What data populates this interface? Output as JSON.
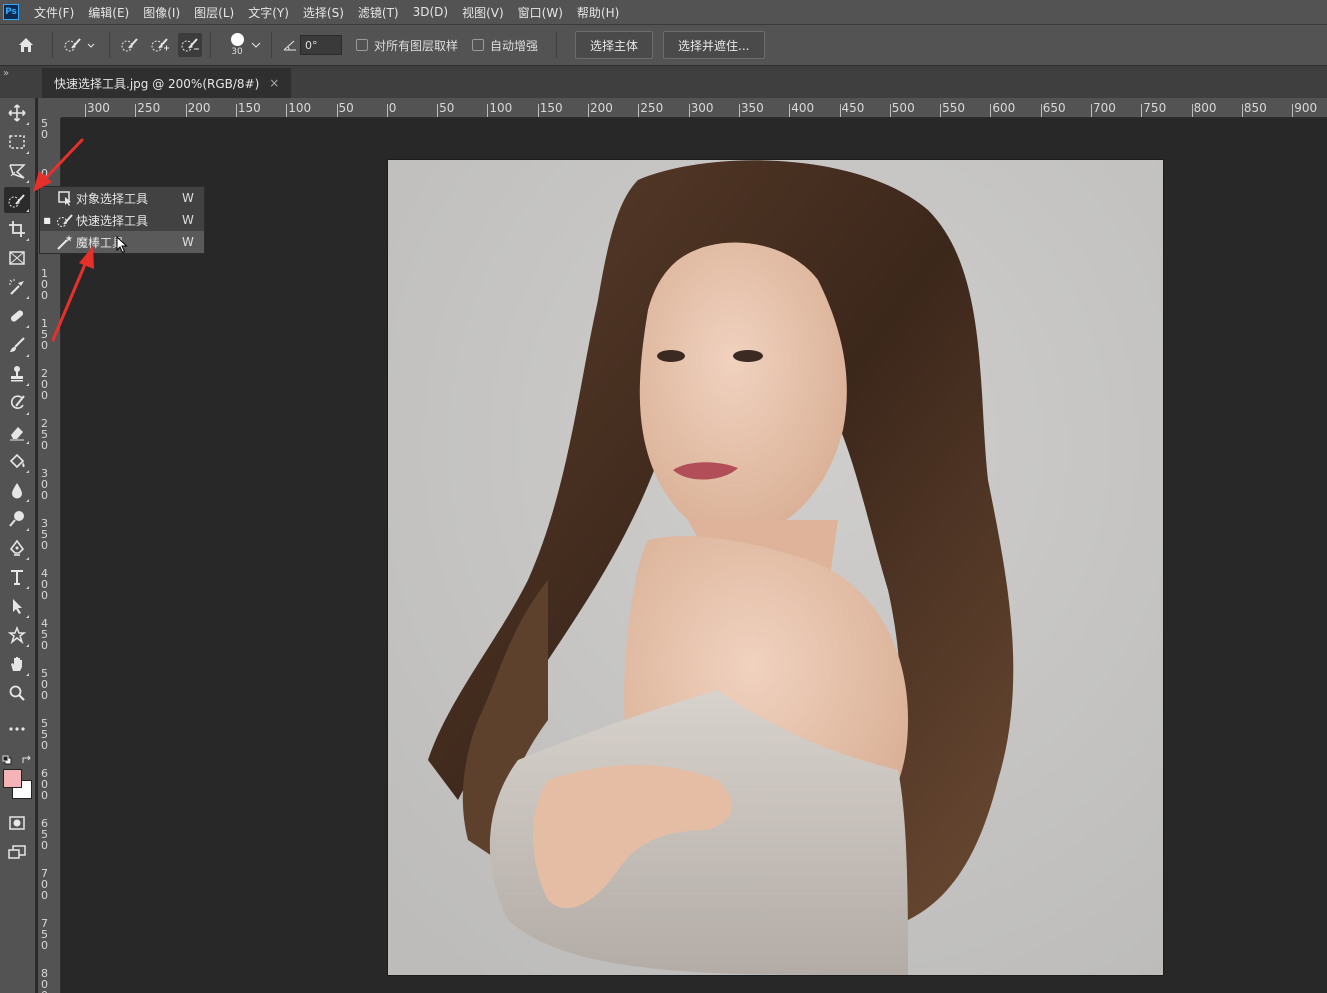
{
  "app": {
    "logo": "Ps"
  },
  "menubar": {
    "items": [
      "文件(F)",
      "编辑(E)",
      "图像(I)",
      "图层(L)",
      "文字(Y)",
      "选择(S)",
      "滤镜(T)",
      "3D(D)",
      "视图(V)",
      "窗口(W)",
      "帮助(H)"
    ]
  },
  "options": {
    "brush_size": "30",
    "angle": "0°",
    "sample_all_layers": "对所有图层取样",
    "auto_enhance": "自动增强",
    "select_subject": "选择主体",
    "select_and_mask": "选择并遮住..."
  },
  "document": {
    "tab_title": "快速选择工具.jpg @ 200%(RGB/8#)",
    "close": "×"
  },
  "panel_collapse": "»",
  "ruler": {
    "top_labels": [
      "300",
      "250",
      "200",
      "150",
      "100",
      "50",
      "0",
      "50",
      "100",
      "150",
      "200",
      "250",
      "300",
      "350",
      "400",
      "450",
      "500",
      "550",
      "600",
      "650",
      "700",
      "750",
      "800",
      "850",
      "900"
    ],
    "left_labels": [
      "50",
      "0",
      "50",
      "100",
      "150",
      "200",
      "250",
      "300",
      "350",
      "400",
      "450",
      "500",
      "550",
      "600",
      "650",
      "700",
      "750",
      "800"
    ]
  },
  "flyout": {
    "items": [
      {
        "label": "对象选择工具",
        "key": "W",
        "icon": "object-selection-icon",
        "current": false
      },
      {
        "label": "快速选择工具",
        "key": "W",
        "icon": "quick-selection-icon",
        "current": true
      },
      {
        "label": "魔棒工具",
        "key": "W",
        "icon": "magic-wand-icon",
        "current": false,
        "hover": true
      }
    ]
  },
  "colors": {
    "foreground": "#f4b3b5",
    "background": "#ffffff",
    "annotation_arrow": "#e8302a"
  }
}
